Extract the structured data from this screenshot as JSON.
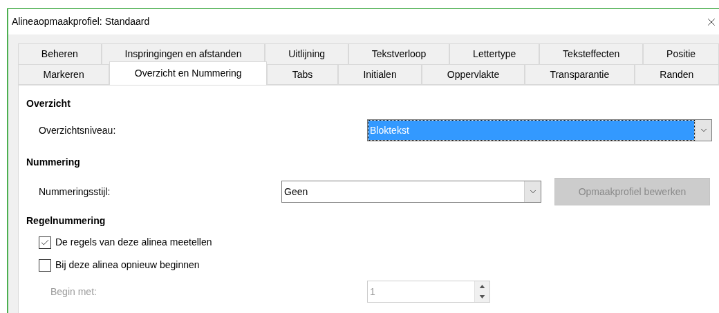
{
  "window": {
    "title": "Alineaopmaakprofiel: Standaard"
  },
  "tab_rows": [
    {
      "tabs": [
        {
          "label": "Beheren",
          "selected": false
        },
        {
          "label": "Inspringingen en afstanden",
          "selected": false
        },
        {
          "label": "Uitlijning",
          "selected": false
        },
        {
          "label": "Tekstverloop",
          "selected": false
        },
        {
          "label": "Lettertype",
          "selected": false
        },
        {
          "label": "Teksteffecten",
          "selected": false
        },
        {
          "label": "Positie",
          "selected": false
        }
      ]
    },
    {
      "tabs": [
        {
          "label": "Markeren",
          "selected": false
        },
        {
          "label": "Overzicht en Nummering",
          "selected": true
        },
        {
          "label": "Tabs",
          "selected": false
        },
        {
          "label": "Initialen",
          "selected": false
        },
        {
          "label": "Oppervlakte",
          "selected": false
        },
        {
          "label": "Transparantie",
          "selected": false
        },
        {
          "label": "Randen",
          "selected": false
        }
      ]
    }
  ],
  "outline": {
    "heading": "Overzicht",
    "level_label": "Overzichtsniveau:",
    "level_value": "Bloktekst",
    "focused": true
  },
  "numbering": {
    "heading": "Nummering",
    "style_label": "Nummeringsstijl:",
    "style_value": "Geen",
    "edit_button": {
      "label": "Opmaakprofiel bewerken",
      "disabled": true
    }
  },
  "line_numbering": {
    "heading": "Regelnummering",
    "checkboxes": [
      {
        "label": "De regels van deze alinea meetellen",
        "checked": true
      },
      {
        "label": "Bij deze alinea opnieuw beginnen",
        "checked": false
      }
    ],
    "start": {
      "label": "Begin met:",
      "value": "1",
      "disabled": true
    }
  }
}
